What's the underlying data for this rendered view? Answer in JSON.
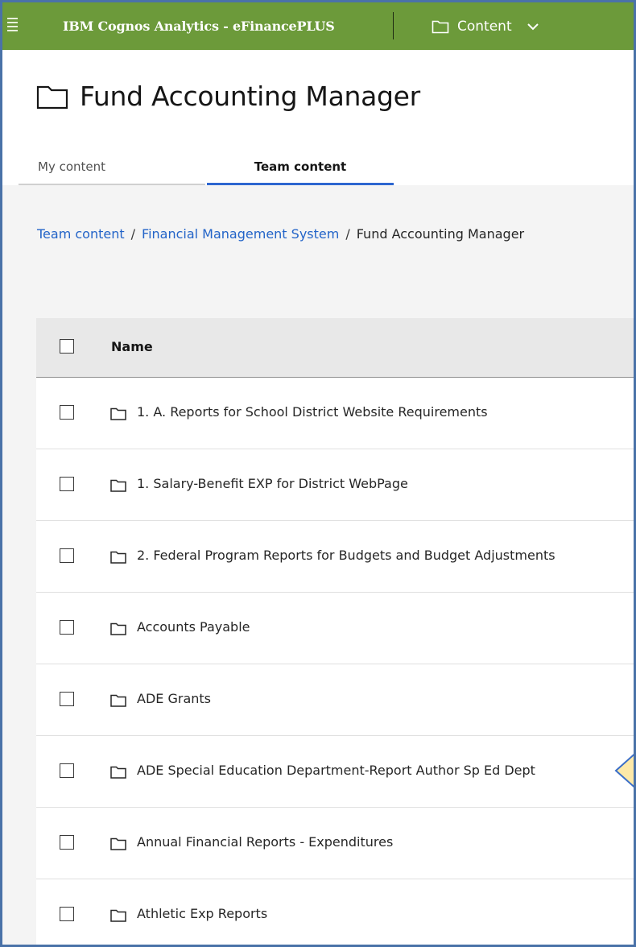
{
  "topbar": {
    "app_title": "IBM Cognos Analytics - eFinancePLUS",
    "content_switcher_label": "Content",
    "menu_icon": "hamburger-icon",
    "folder_icon": "folder-icon",
    "chevron_icon": "chevron-down-icon",
    "bg_color": "#6c9a3a"
  },
  "page": {
    "title": "Fund Accounting Manager",
    "title_icon": "folder-icon"
  },
  "tabs": [
    {
      "label": "My content",
      "active": false
    },
    {
      "label": "Team content",
      "active": true
    }
  ],
  "breadcrumb": {
    "items": [
      "Team content",
      "Financial Management System"
    ],
    "separator": "/",
    "current": "Fund Accounting Manager"
  },
  "table": {
    "header": {
      "name": "Name"
    },
    "rows": [
      {
        "name": "1. A. Reports for School District Website Requirements"
      },
      {
        "name": "1. Salary-Benefit EXP for District WebPage"
      },
      {
        "name": "2. Federal Program Reports for Budgets and Budget Adjustments"
      },
      {
        "name": "Accounts Payable"
      },
      {
        "name": "ADE Grants"
      },
      {
        "name": "ADE Special Education Department-Report Author Sp Ed Dept"
      },
      {
        "name": "Annual Financial Reports - Expenditures"
      },
      {
        "name": "Athletic Exp Reports"
      }
    ]
  },
  "colors": {
    "accent": "#2d66d0",
    "link": "#2364c8",
    "callout_fill": "#fde9a8",
    "callout_stroke": "#3a6ec8"
  }
}
